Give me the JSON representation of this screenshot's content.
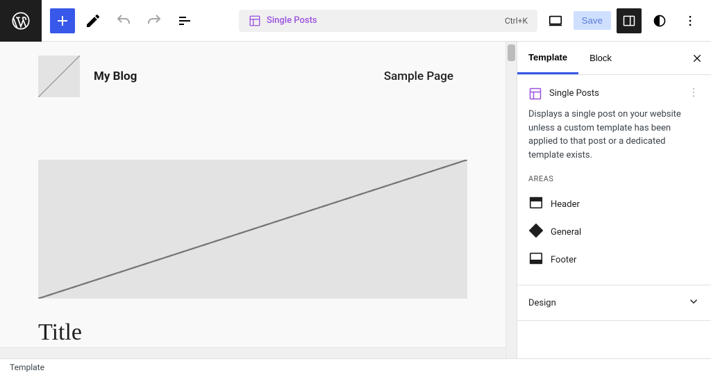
{
  "toolbar": {
    "save_label": "Save",
    "center_label": "Single Posts",
    "shortcut": "Ctrl+K"
  },
  "canvas": {
    "site_title": "My Blog",
    "nav_link": "Sample Page",
    "post_title": "Title"
  },
  "sidebar": {
    "tabs": {
      "template": "Template",
      "block": "Block"
    },
    "template_name": "Single Posts",
    "description": "Displays a single post on your website unless a custom template has been applied to that post or a dedicated template exists.",
    "areas_heading": "AREAS",
    "areas": [
      {
        "label": "Header"
      },
      {
        "label": "General"
      },
      {
        "label": "Footer"
      }
    ],
    "design_label": "Design"
  },
  "footer": {
    "breadcrumb": "Template"
  },
  "colors": {
    "accent": "#3858e9",
    "template_accent": "#9b51e0"
  }
}
